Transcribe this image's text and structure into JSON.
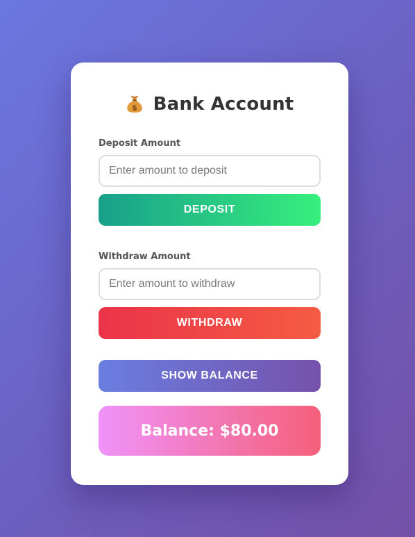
{
  "app": {
    "title": "Bank Account",
    "icon": "money-bag-icon"
  },
  "deposit": {
    "label": "Deposit Amount",
    "placeholder": "Enter amount to deposit",
    "value": "",
    "button_label": "DEPOSIT"
  },
  "withdraw": {
    "label": "Withdraw Amount",
    "placeholder": "Enter amount to withdraw",
    "value": "",
    "button_label": "WITHDRAW"
  },
  "show_balance": {
    "button_label": "SHOW BALANCE"
  },
  "balance": {
    "text": "Balance: $80.00"
  },
  "colors": {
    "background_start": "#6a78e0",
    "background_end": "#7450a8",
    "deposit_start": "#17a08a",
    "deposit_end": "#38ef7d",
    "withdraw_start": "#eb3349",
    "withdraw_end": "#f45c43",
    "balance_button_start": "#6a7ee0",
    "balance_button_end": "#7552ac",
    "balance_box_start": "#f092f9",
    "balance_box_end": "#f4607a"
  }
}
